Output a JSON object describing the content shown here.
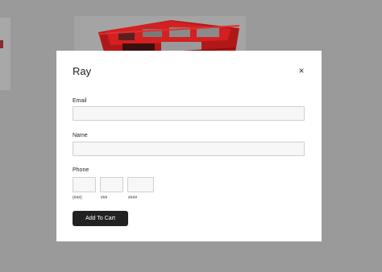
{
  "modal": {
    "title": "Ray",
    "close_icon": "close-icon"
  },
  "form": {
    "email_label": "Email",
    "email_value": "",
    "name_label": "Name",
    "name_value": "",
    "phone_label": "Phone",
    "phone_parts": [
      {
        "value": "",
        "hint": "(###)"
      },
      {
        "value": "",
        "hint": "###"
      },
      {
        "value": "",
        "hint": "####"
      }
    ],
    "submit_label": "Add To Cart"
  },
  "colors": {
    "overlay": "#9a9a9a",
    "product_red": "#d42020",
    "button_bg": "#222222"
  }
}
